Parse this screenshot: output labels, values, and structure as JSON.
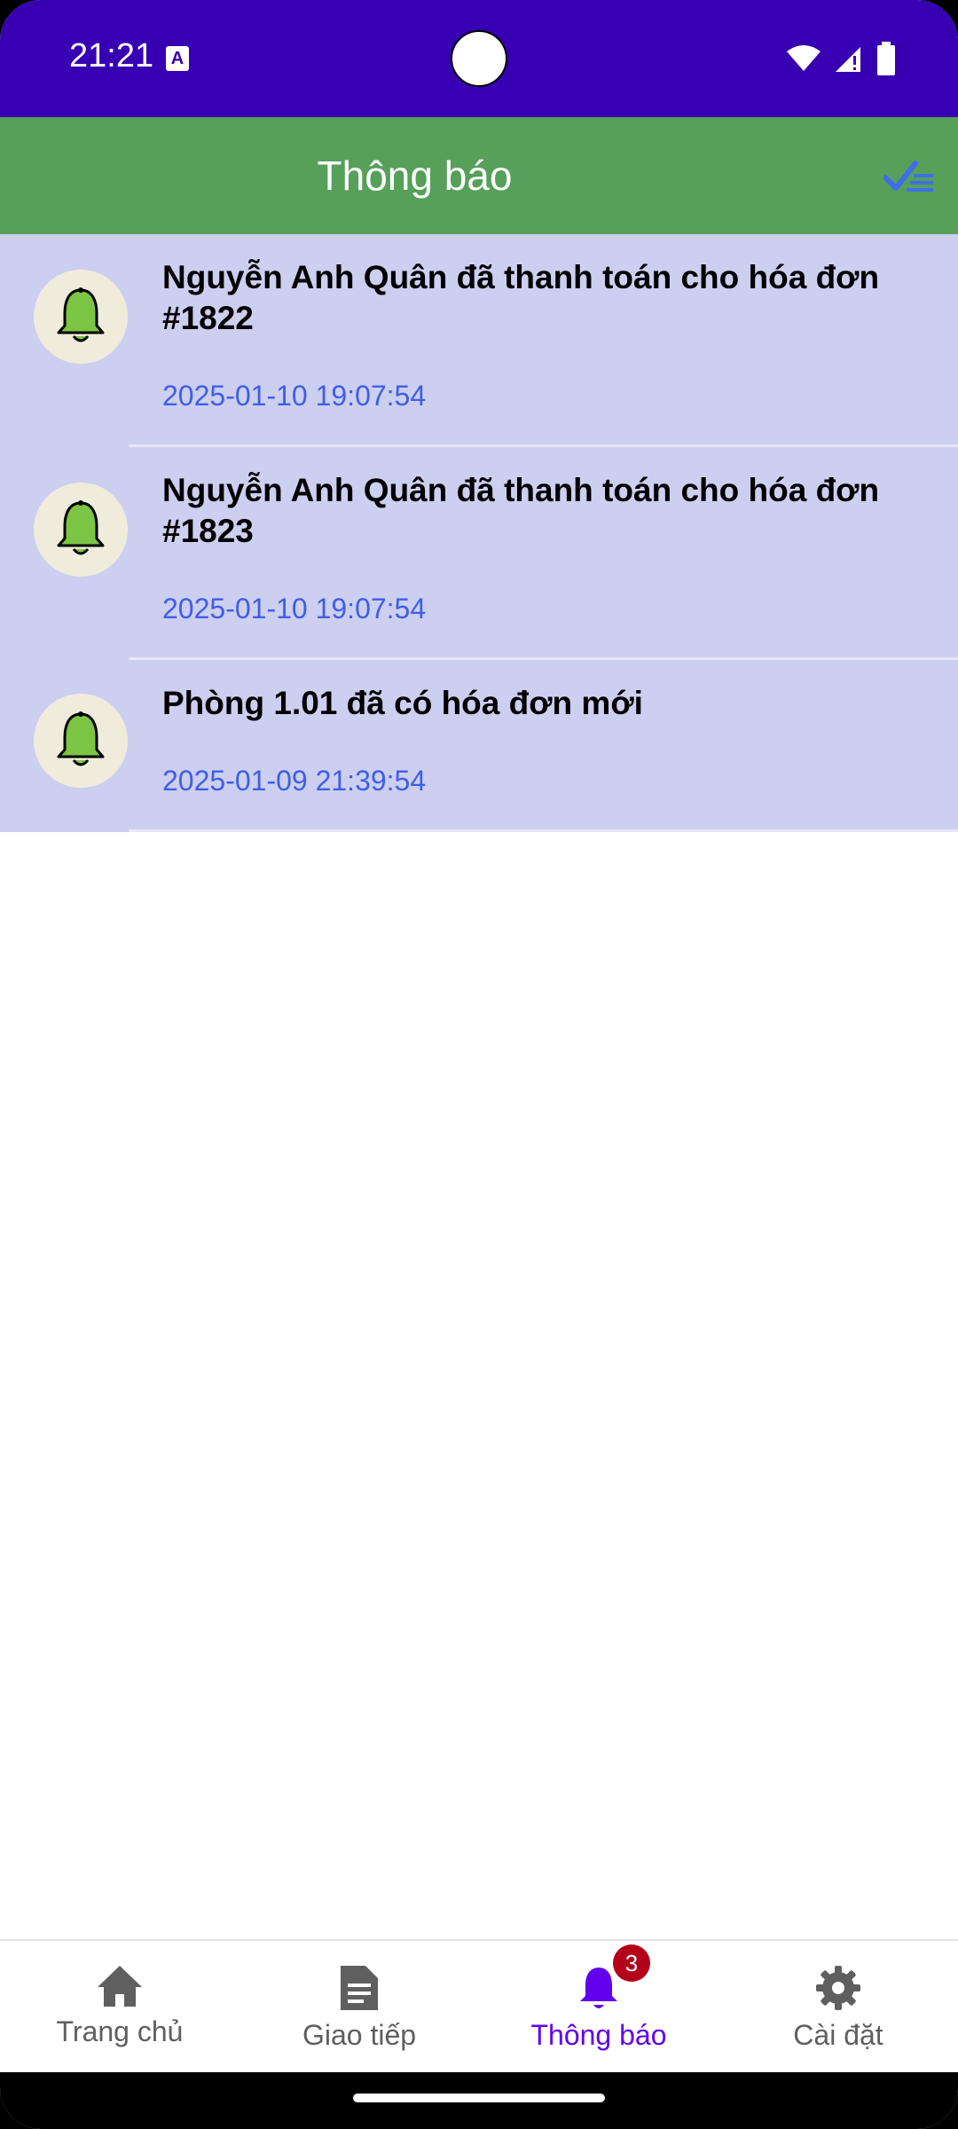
{
  "status_bar": {
    "time": "21:21",
    "notification_icon": "keyboard-a-icon",
    "icons": [
      "wifi-icon",
      "signal-icon",
      "battery-icon"
    ]
  },
  "app_bar": {
    "title": "Thông báo",
    "action_icon": "mark-all-read-icon"
  },
  "notifications": [
    {
      "title": "Nguyễn Anh Quân đã thanh toán cho hóa đơn #1822",
      "time": "2025-01-10 19:07:54",
      "icon": "bell-icon"
    },
    {
      "title": "Nguyễn Anh Quân đã thanh toán cho hóa đơn #1823",
      "time": "2025-01-10 19:07:54",
      "icon": "bell-icon"
    },
    {
      "title": "Phòng 1.01 đã có hóa đơn mới",
      "time": "2025-01-09 21:39:54",
      "icon": "bell-icon"
    }
  ],
  "bottom_nav": {
    "items": [
      {
        "label": "Trang chủ",
        "icon": "home-icon"
      },
      {
        "label": "Giao tiếp",
        "icon": "document-icon"
      },
      {
        "label": "Thông báo",
        "icon": "bell-icon",
        "badge": "3",
        "active": true
      },
      {
        "label": "Cài đặt",
        "icon": "gear-icon"
      }
    ]
  },
  "colors": {
    "status_bar": "#3700b3",
    "app_bar": "#56a05a",
    "unread_item_bg": "#cccff0",
    "timestamp": "#3f5ee8",
    "active_nav": "#6200ee",
    "badge": "#b3001b",
    "bell": "#7cc444"
  }
}
